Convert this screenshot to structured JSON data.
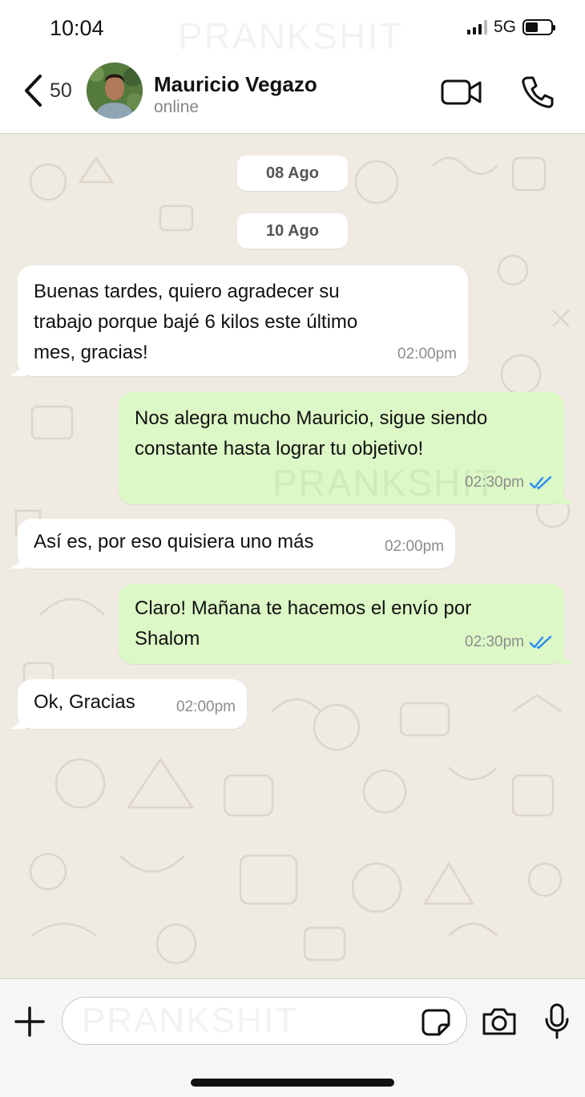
{
  "status_bar": {
    "time": "10:04",
    "network": "5G",
    "battery_level": 0.5
  },
  "watermark": "PRANKSHIT",
  "header": {
    "back_count": "50",
    "contact_name": "Mauricio Vegazo",
    "contact_status": "online",
    "icons": [
      "back-chevron-icon",
      "video-call-icon",
      "phone-call-icon"
    ]
  },
  "chat": {
    "dates": [
      "08 Ago",
      "10 Ago"
    ],
    "messages": [
      {
        "direction": "in",
        "text": "Buenas tardes, quiero agradecer su\ntrabajo porque bajé 6 kilos este último\nmes, gracias!",
        "time": "02:00pm"
      },
      {
        "direction": "out",
        "text": "Nos alegra mucho Mauricio, sigue siendo\nconstante hasta lograr tu objetivo!",
        "time": "02:30pm",
        "status": "read"
      },
      {
        "direction": "in",
        "text": "Así es, por eso quisiera uno más",
        "time": "02:00pm"
      },
      {
        "direction": "out",
        "text": "Claro! Mañana te hacemos el envío por\nShalom",
        "time": "02:30pm",
        "status": "read"
      },
      {
        "direction": "in",
        "text": "Ok, Gracias",
        "time": "02:00pm"
      }
    ]
  },
  "composer": {
    "placeholder": ""
  },
  "colors": {
    "incoming_bubble": "#ffffff",
    "outgoing_bubble": "#dcf8c6",
    "chat_background": "#efeae2",
    "read_ticks": "#2b8cf0",
    "timestamp": "#8c8c8c"
  }
}
